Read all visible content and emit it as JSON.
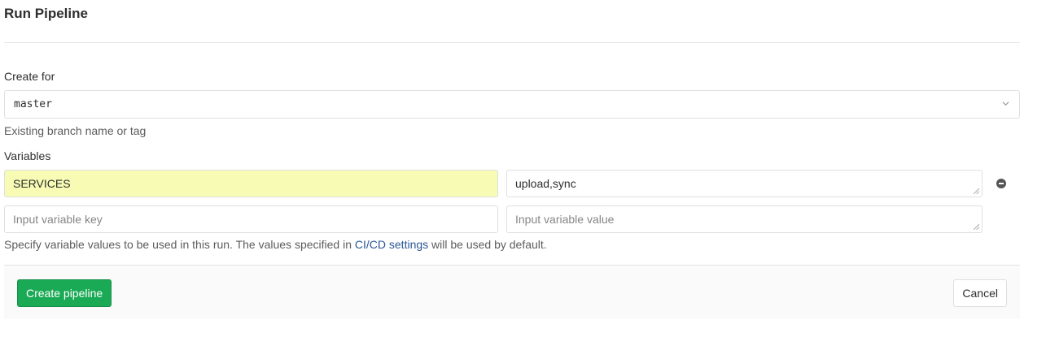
{
  "page": {
    "title": "Run Pipeline"
  },
  "form": {
    "create_for_label": "Create for",
    "ref_value": "master",
    "ref_help": "Existing branch name or tag",
    "variables_label": "Variables",
    "variables": [
      {
        "key": "SERVICES",
        "value": "upload,sync"
      },
      {
        "key": "",
        "value": ""
      }
    ],
    "key_placeholder": "Input variable key",
    "value_placeholder": "Input variable value",
    "vars_help_prefix": "Specify variable values to be used in this run. The values specified in ",
    "vars_help_link": "CI/CD settings",
    "vars_help_suffix": " will be used by default."
  },
  "actions": {
    "create_label": "Create pipeline",
    "cancel_label": "Cancel"
  },
  "colors": {
    "primary_button": "#1aaa55",
    "link": "#2b5797",
    "autofill_highlight": "#f7fbb4"
  },
  "icons": {
    "dropdown": "chevron-down-icon",
    "remove_variable": "remove-icon"
  }
}
